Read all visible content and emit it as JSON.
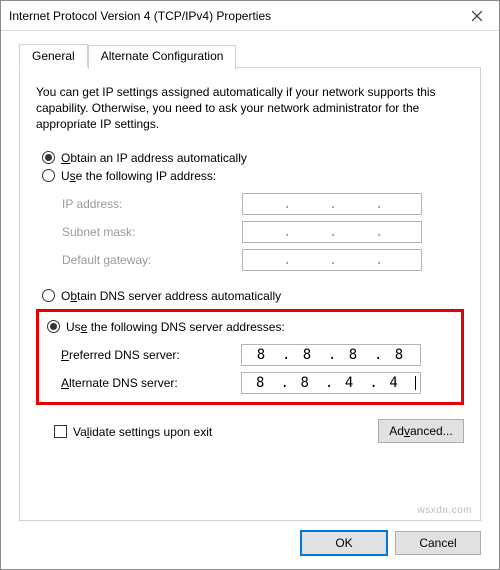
{
  "window": {
    "title": "Internet Protocol Version 4 (TCP/IPv4) Properties"
  },
  "tabs": {
    "general": "General",
    "alternate": "Alternate Configuration",
    "active": "general"
  },
  "description": "You can get IP settings assigned automatically if your network supports this capability. Otherwise, you need to ask your network administrator for the appropriate IP settings.",
  "ip_section": {
    "auto_label": "Obtain an IP address automatically",
    "manual_label": "Use the following IP address:",
    "selected": "auto",
    "fields": {
      "ip_address_label": "IP address:",
      "subnet_label": "Subnet mask:",
      "gateway_label": "Default gateway:",
      "ip_address": [
        "",
        "",
        "",
        ""
      ],
      "subnet": [
        "",
        "",
        "",
        ""
      ],
      "gateway": [
        "",
        "",
        "",
        ""
      ]
    }
  },
  "dns_section": {
    "auto_label": "Obtain DNS server address automatically",
    "manual_label": "Use the following DNS server addresses:",
    "selected": "manual",
    "fields": {
      "preferred_label": "Preferred DNS server:",
      "alternate_label": "Alternate DNS server:",
      "preferred": [
        "8",
        "8",
        "8",
        "8"
      ],
      "alternate": [
        "8",
        "8",
        "4",
        "4"
      ]
    }
  },
  "validate_label": "Validate settings upon exit",
  "validate_checked": false,
  "buttons": {
    "advanced": "Advanced...",
    "ok": "OK",
    "cancel": "Cancel"
  },
  "watermark": "wsxdn.com"
}
